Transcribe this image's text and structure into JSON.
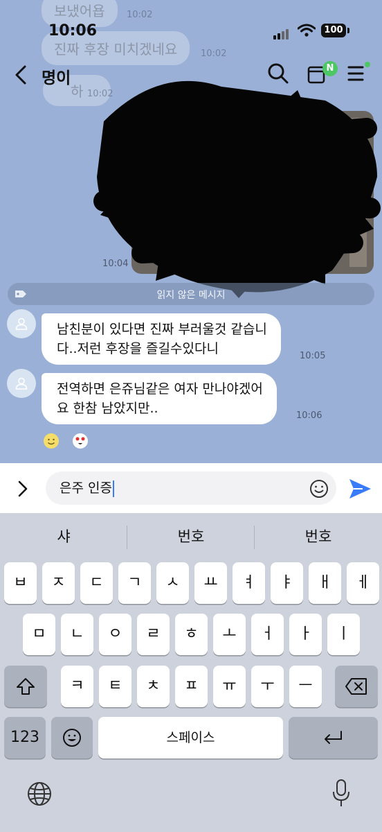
{
  "status_bar": {
    "time": "10:06",
    "battery": "100"
  },
  "header": {
    "title": "명이"
  },
  "background_messages": [
    {
      "text": "보냈어욥",
      "time": "10:02"
    },
    {
      "text": "진짜 후장 미치겠네요",
      "time": "10:02"
    },
    {
      "text": "하",
      "time": "10:02"
    }
  ],
  "photo_message": {
    "time": "10:04"
  },
  "unread_divider": {
    "label": "읽지 않은 메시지"
  },
  "messages": [
    {
      "lines": [
        "남친분이 있다면 진짜 부러울것 같습니",
        "다..저런 후장을  즐길수있다니"
      ],
      "time": "10:05"
    },
    {
      "lines": [
        "전역하면 은쥬님같은 여자 만나야겠어",
        "요 한참 남았지만.."
      ],
      "time": "10:06"
    }
  ],
  "input": {
    "value": "은주 인증"
  },
  "keyboard": {
    "suggestions": [
      "샤",
      "번호",
      "번호"
    ],
    "row1": [
      "ㅂ",
      "ㅈ",
      "ㄷ",
      "ㄱ",
      "ㅅ",
      "ㅛ",
      "ㅕ",
      "ㅑ",
      "ㅐ",
      "ㅔ"
    ],
    "row2": [
      "ㅁ",
      "ㄴ",
      "ㅇ",
      "ㄹ",
      "ㅎ",
      "ㅗ",
      "ㅓ",
      "ㅏ",
      "ㅣ"
    ],
    "row3": [
      "ㅋ",
      "ㅌ",
      "ㅊ",
      "ㅍ",
      "ㅠ",
      "ㅜ",
      "ㅡ"
    ],
    "numbers_label": "123",
    "space_label": "스페이스"
  },
  "colors": {
    "chat_bg": "#9bb0d6",
    "send": "#3a7bfa",
    "badge": "#4cc764"
  }
}
